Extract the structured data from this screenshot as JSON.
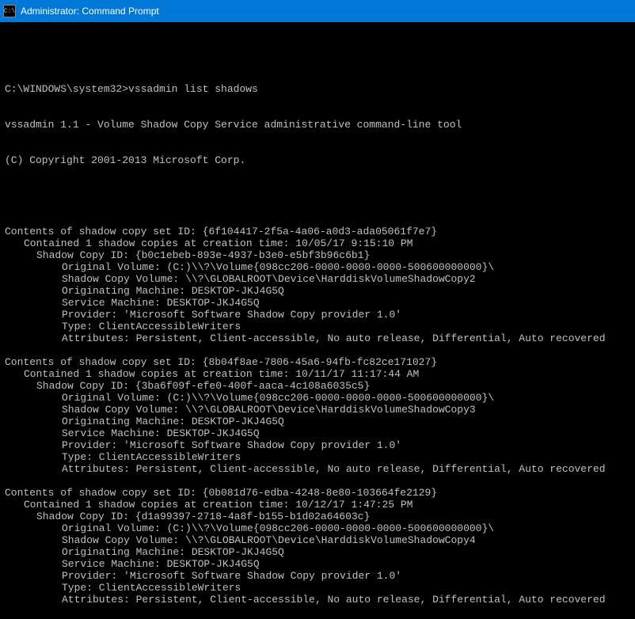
{
  "window": {
    "title": "Administrator: Command Prompt",
    "icon_glyph": "C:\\"
  },
  "prompt": {
    "path": "C:\\WINDOWS\\system32>",
    "command": "vssadmin list shadows"
  },
  "banner": {
    "line1": "vssadmin 1.1 - Volume Shadow Copy Service administrative command-line tool",
    "line2": "(C) Copyright 2001-2013 Microsoft Corp."
  },
  "labels": {
    "contents_prefix": "Contents of shadow copy set ID: ",
    "contained_prefix": "Contained 1 shadow copies at creation time: ",
    "shadow_copy_id_prefix": "Shadow Copy ID: ",
    "original_volume_prefix": "Original Volume: ",
    "shadow_copy_volume_prefix": "Shadow Copy Volume: ",
    "originating_machine_prefix": "Originating Machine: ",
    "service_machine_prefix": "Service Machine: ",
    "provider_prefix": "Provider: ",
    "type_prefix": "Type: ",
    "attributes_prefix": "Attributes: "
  },
  "sets": [
    {
      "set_id": "{6f104417-2f5a-4a06-a0d3-ada05061f7e7}",
      "creation_time": "10/05/17 9:15:10 PM",
      "copy_id": "{b0c1ebeb-893e-4937-b3e0-e5bf3b96c6b1}",
      "original_volume": "(C:)\\\\?\\Volume{098cc206-0000-0000-0000-500600000000}\\",
      "shadow_copy_volume": "\\\\?\\GLOBALROOT\\Device\\HarddiskVolumeShadowCopy2",
      "originating_machine": "DESKTOP-JKJ4G5Q",
      "service_machine": "DESKTOP-JKJ4G5Q",
      "provider": "'Microsoft Software Shadow Copy provider 1.0'",
      "type": "ClientAccessibleWriters",
      "attributes": "Persistent, Client-accessible, No auto release, Differential, Auto recovered"
    },
    {
      "set_id": "{8b04f8ae-7806-45a6-94fb-fc82ce171027}",
      "creation_time": "10/11/17 11:17:44 AM",
      "copy_id": "{3ba6f09f-efe0-400f-aaca-4c108a6035c5}",
      "original_volume": "(C:)\\\\?\\Volume{098cc206-0000-0000-0000-500600000000}\\",
      "shadow_copy_volume": "\\\\?\\GLOBALROOT\\Device\\HarddiskVolumeShadowCopy3",
      "originating_machine": "DESKTOP-JKJ4G5Q",
      "service_machine": "DESKTOP-JKJ4G5Q",
      "provider": "'Microsoft Software Shadow Copy provider 1.0'",
      "type": "ClientAccessibleWriters",
      "attributes": "Persistent, Client-accessible, No auto release, Differential, Auto recovered"
    },
    {
      "set_id": "{0b081d76-edba-4248-8e80-103664fe2129}",
      "creation_time": "10/12/17 1:47:25 PM",
      "copy_id": "{d1a99397-2718-4a8f-b155-b1d02a64603c}",
      "original_volume": "(C:)\\\\?\\Volume{098cc206-0000-0000-0000-500600000000}\\",
      "shadow_copy_volume": "\\\\?\\GLOBALROOT\\Device\\HarddiskVolumeShadowCopy4",
      "originating_machine": "DESKTOP-JKJ4G5Q",
      "service_machine": "DESKTOP-JKJ4G5Q",
      "provider": "'Microsoft Software Shadow Copy provider 1.0'",
      "type": "ClientAccessibleWriters",
      "attributes": "Persistent, Client-accessible, No auto release, Differential, Auto recovered"
    }
  ]
}
